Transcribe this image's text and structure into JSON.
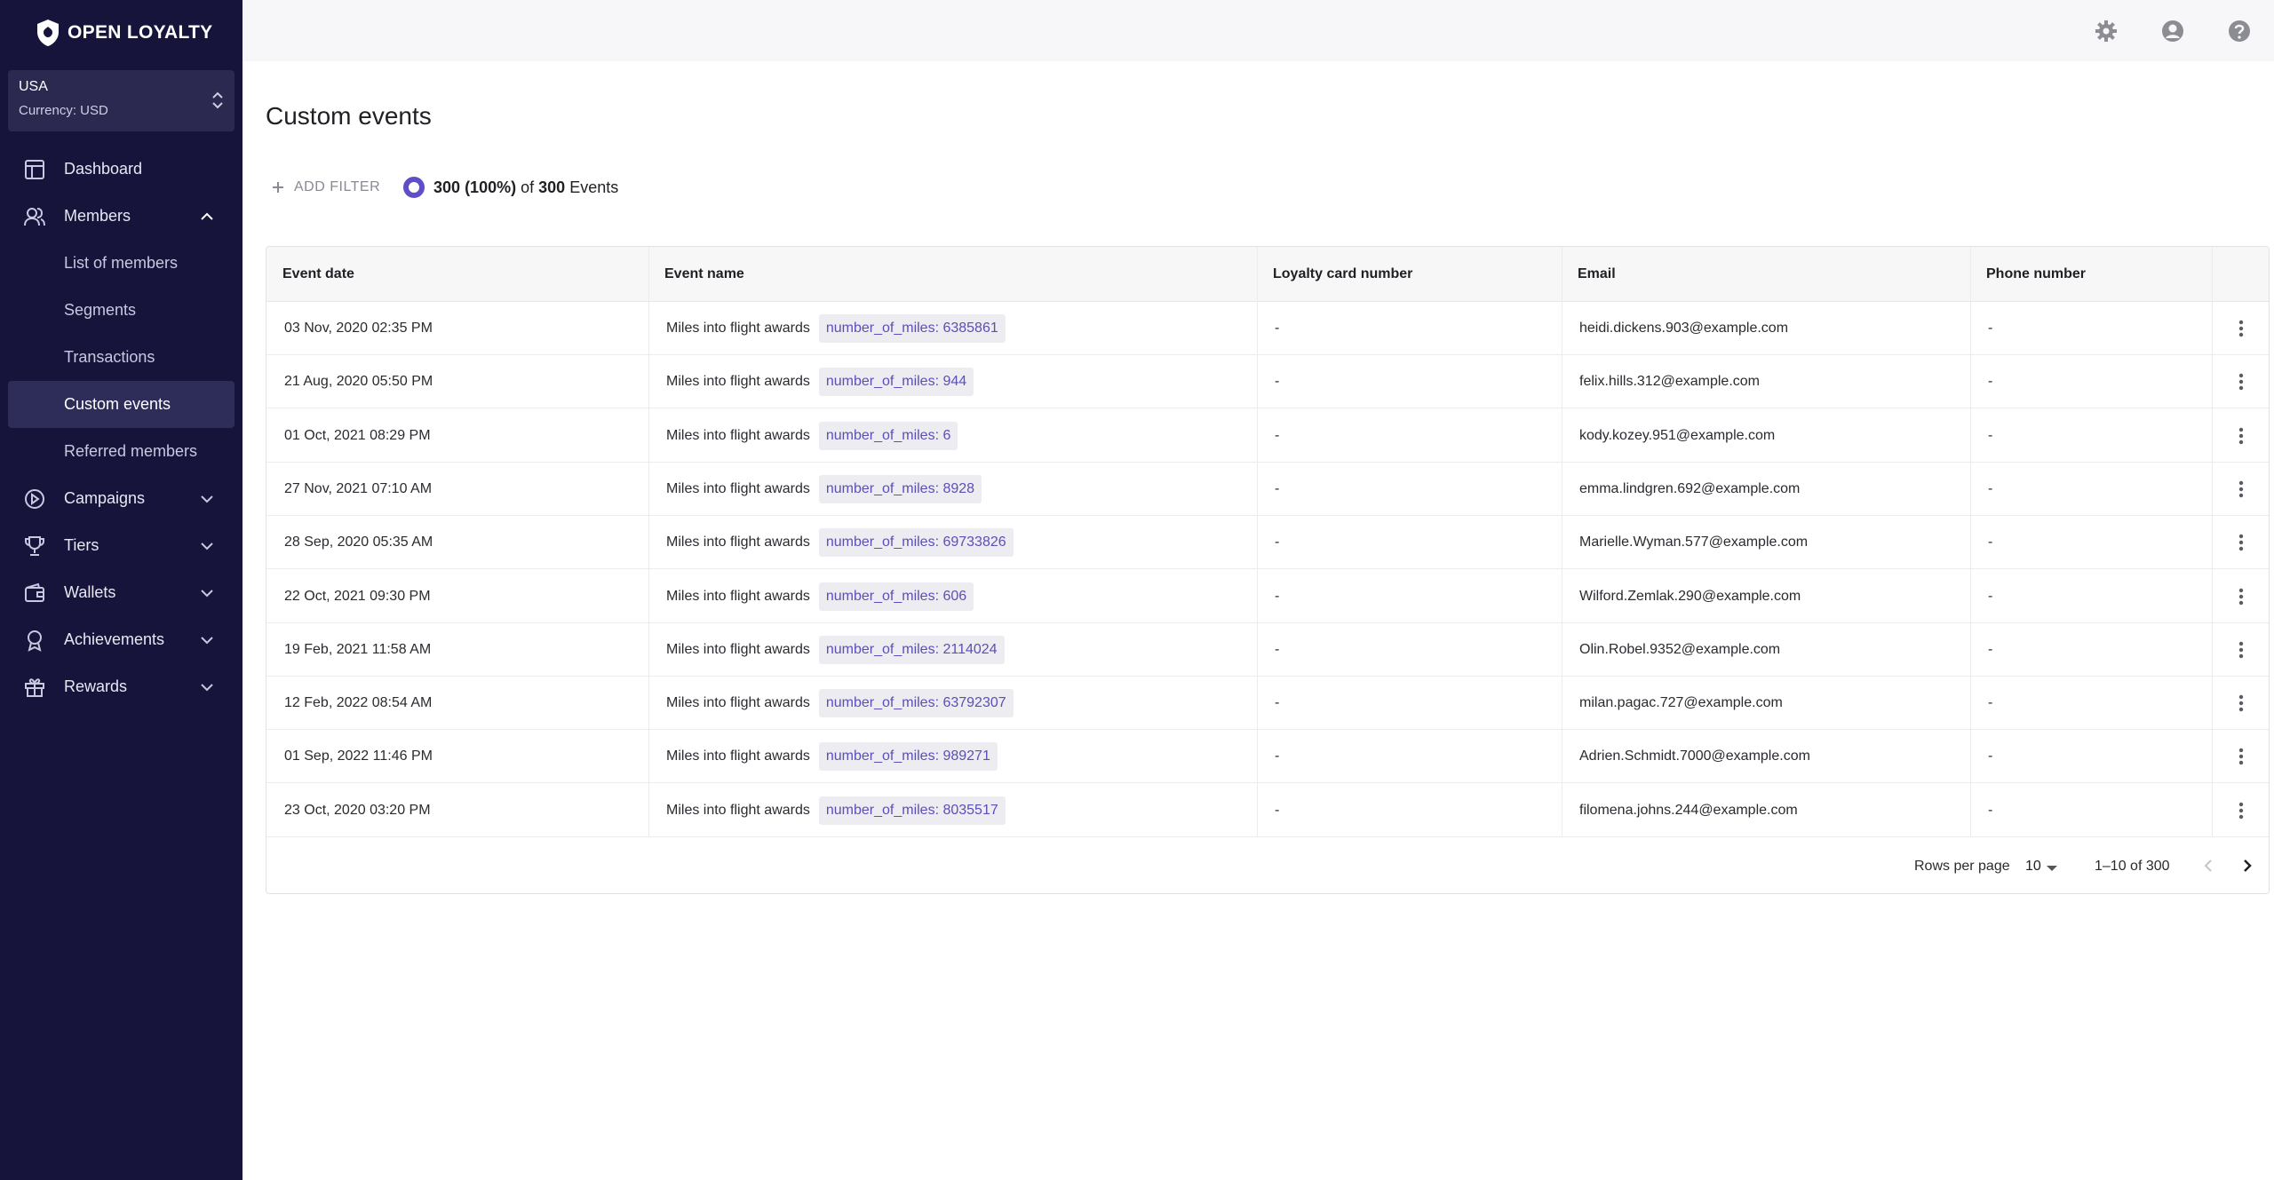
{
  "brand": {
    "logo_text": "OPEN LOYALTY"
  },
  "market": {
    "name": "USA",
    "currency": "Currency: USD"
  },
  "sidebar": {
    "items": [
      {
        "label": "Dashboard",
        "icon": "dashboard-icon"
      },
      {
        "label": "Members",
        "icon": "members-icon",
        "expanded": true
      },
      {
        "label": "List of members",
        "sub": true
      },
      {
        "label": "Segments",
        "sub": true
      },
      {
        "label": "Transactions",
        "sub": true
      },
      {
        "label": "Custom events",
        "sub": true,
        "active": true
      },
      {
        "label": "Referred members",
        "sub": true
      },
      {
        "label": "Campaigns",
        "icon": "campaigns-icon"
      },
      {
        "label": "Tiers",
        "icon": "trophy-icon"
      },
      {
        "label": "Wallets",
        "icon": "wallet-icon"
      },
      {
        "label": "Achievements",
        "icon": "medal-icon"
      },
      {
        "label": "Rewards",
        "icon": "gift-icon"
      }
    ]
  },
  "topbar": {
    "icons": [
      "gear-icon",
      "account-icon",
      "help-icon"
    ]
  },
  "page": {
    "title": "Custom events"
  },
  "filter": {
    "add_label": "ADD FILTER"
  },
  "summary": {
    "count": "300",
    "percent": "(100%)",
    "of": "of",
    "total": "300",
    "unit": "Events"
  },
  "table": {
    "headers": [
      "Event date",
      "Event name",
      "Loyalty card number",
      "Email",
      "Phone number"
    ],
    "rows": [
      {
        "date": "03 Nov, 2020 02:35 PM",
        "event": "Miles into flight awards",
        "tag": "number_of_miles: 6385861",
        "card": "-",
        "email": "heidi.dickens.903@example.com",
        "phone": "-"
      },
      {
        "date": "21 Aug, 2020 05:50 PM",
        "event": "Miles into flight awards",
        "tag": "number_of_miles: 944",
        "card": "-",
        "email": "felix.hills.312@example.com",
        "phone": "-"
      },
      {
        "date": "01 Oct, 2021 08:29 PM",
        "event": "Miles into flight awards",
        "tag": "number_of_miles: 6",
        "card": "-",
        "email": "kody.kozey.951@example.com",
        "phone": "-"
      },
      {
        "date": "27 Nov, 2021 07:10 AM",
        "event": "Miles into flight awards",
        "tag": "number_of_miles: 8928",
        "card": "-",
        "email": "emma.lindgren.692@example.com",
        "phone": "-"
      },
      {
        "date": "28 Sep, 2020 05:35 AM",
        "event": "Miles into flight awards",
        "tag": "number_of_miles: 69733826",
        "card": "-",
        "email": "Marielle.Wyman.577@example.com",
        "phone": "-"
      },
      {
        "date": "22 Oct, 2021 09:30 PM",
        "event": "Miles into flight awards",
        "tag": "number_of_miles: 606",
        "card": "-",
        "email": "Wilford.Zemlak.290@example.com",
        "phone": "-"
      },
      {
        "date": "19 Feb, 2021 11:58 AM",
        "event": "Miles into flight awards",
        "tag": "number_of_miles: 2114024",
        "card": "-",
        "email": "Olin.Robel.9352@example.com",
        "phone": "-"
      },
      {
        "date": "12 Feb, 2022 08:54 AM",
        "event": "Miles into flight awards",
        "tag": "number_of_miles: 63792307",
        "card": "-",
        "email": "milan.pagac.727@example.com",
        "phone": "-"
      },
      {
        "date": "01 Sep, 2022 11:46 PM",
        "event": "Miles into flight awards",
        "tag": "number_of_miles: 989271",
        "card": "-",
        "email": "Adrien.Schmidt.7000@example.com",
        "phone": "-"
      },
      {
        "date": "23 Oct, 2020 03:20 PM",
        "event": "Miles into flight awards",
        "tag": "number_of_miles: 8035517",
        "card": "-",
        "email": "filomena.johns.244@example.com",
        "phone": "-"
      }
    ]
  },
  "pagination": {
    "rows_per_page_label": "Rows per page",
    "rows_per_page": "10",
    "range": "1–10 of 300"
  },
  "colors": {
    "sidebar": "#16143b",
    "accent": "#5f4fc7",
    "tag_text": "#5b4fb8"
  }
}
